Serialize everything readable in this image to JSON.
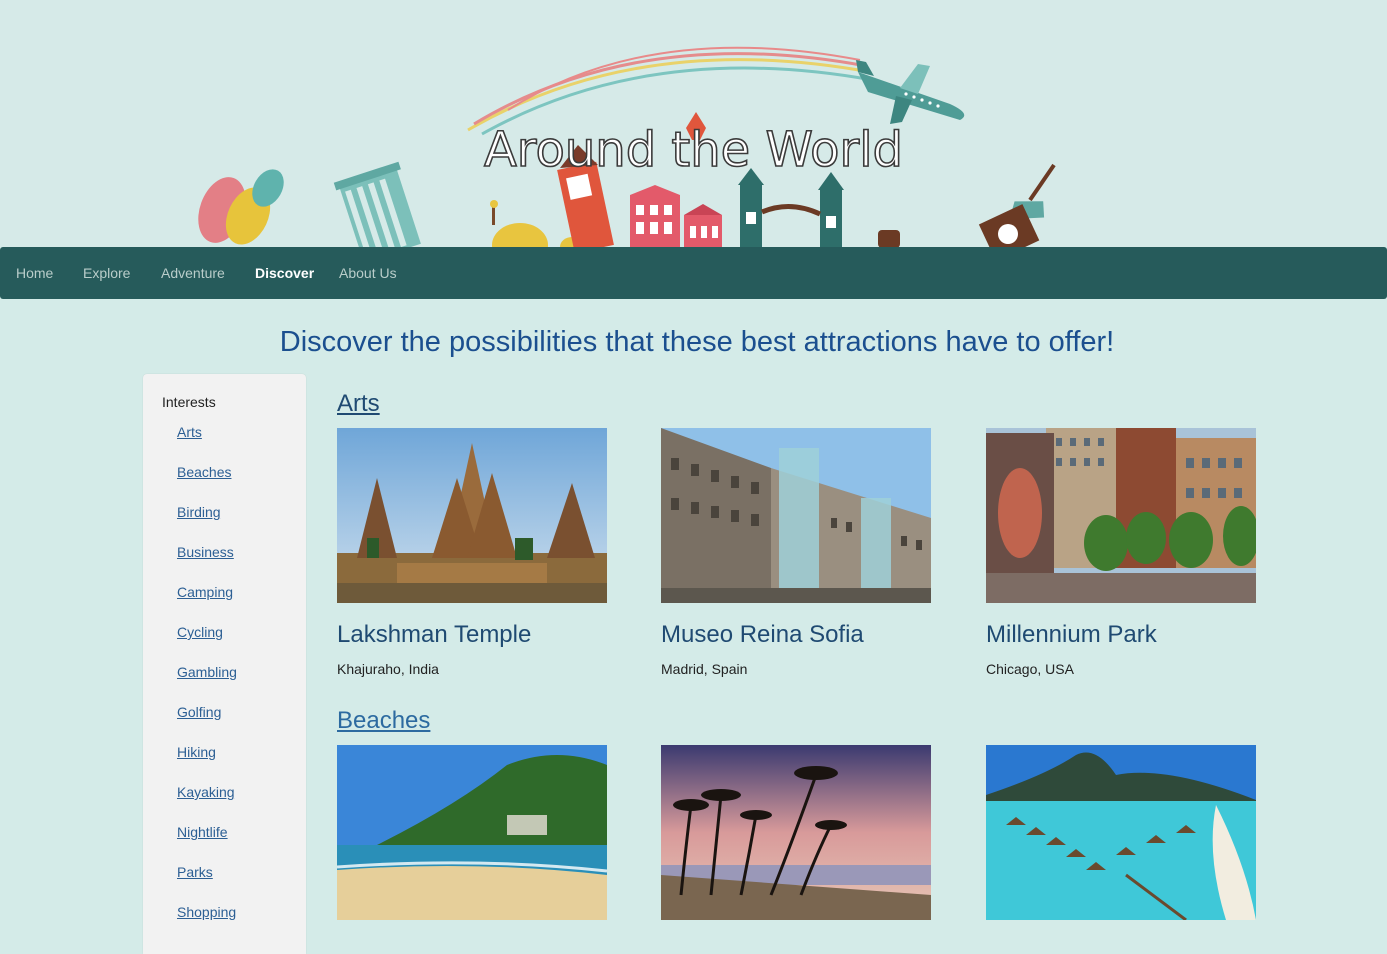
{
  "site": {
    "title": "Around the World"
  },
  "nav": {
    "items": [
      {
        "label": "Home",
        "active": false
      },
      {
        "label": "Explore",
        "active": false
      },
      {
        "label": "Adventure",
        "active": false
      },
      {
        "label": "Discover",
        "active": true
      },
      {
        "label": "About Us",
        "active": false
      }
    ]
  },
  "main": {
    "headline": "Discover the possibilities that these best attractions have to offer!"
  },
  "sidebar": {
    "title": "Interests",
    "items": [
      {
        "label": "Arts"
      },
      {
        "label": "Beaches"
      },
      {
        "label": "Birding"
      },
      {
        "label": "Business"
      },
      {
        "label": "Camping"
      },
      {
        "label": "Cycling"
      },
      {
        "label": "Gambling"
      },
      {
        "label": "Golfing"
      },
      {
        "label": "Hiking"
      },
      {
        "label": "Kayaking"
      },
      {
        "label": "Nightlife"
      },
      {
        "label": "Parks"
      },
      {
        "label": "Shopping"
      }
    ]
  },
  "sections": [
    {
      "title": "Arts",
      "attractions": [
        {
          "name": "Lakshman Temple",
          "location": "Khajuraho, India",
          "photo": "temple-photo"
        },
        {
          "name": "Museo Reina Sofia",
          "location": "Madrid, Spain",
          "photo": "museum-photo"
        },
        {
          "name": "Millennium Park",
          "location": "Chicago, USA",
          "photo": "park-photo"
        }
      ]
    },
    {
      "title": "Beaches",
      "attractions": [
        {
          "photo": "beach-hill-photo"
        },
        {
          "photo": "beach-palms-photo"
        },
        {
          "photo": "beach-bungalows-photo"
        }
      ]
    }
  ],
  "colors": {
    "background": "#d4ebe8",
    "navbar": "#265b5b",
    "headline": "#1b4f8f",
    "link": "#2c5f94"
  }
}
